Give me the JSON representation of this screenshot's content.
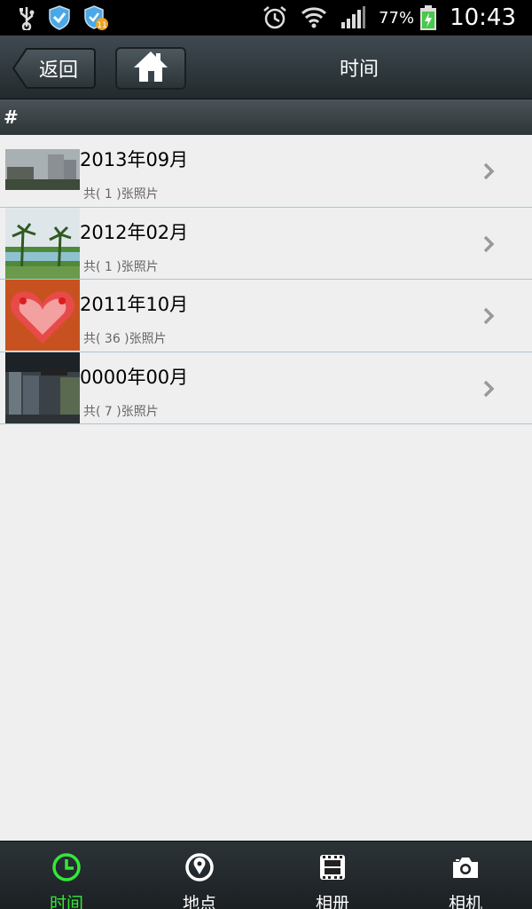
{
  "status_bar": {
    "battery_percent": "77%",
    "time": "10:43",
    "icons": [
      "usb-icon",
      "shield-icon",
      "shield-badge-icon",
      "alarm-icon",
      "wifi-icon",
      "signal-icon",
      "battery-charging-icon"
    ]
  },
  "header": {
    "back_label": "返回",
    "home_icon": "home-icon",
    "title": "时间"
  },
  "section": {
    "label": "#"
  },
  "items": [
    {
      "title": "2013年09月",
      "subtitle": "共( 1 )张照片",
      "thumb": "city-photo"
    },
    {
      "title": "2012年02月",
      "subtitle": "共( 1 )张照片",
      "thumb": "palm-resort-photo"
    },
    {
      "title": "2011年10月",
      "subtitle": "共( 36 )张照片",
      "thumb": "heart-cake-photo"
    },
    {
      "title": "0000年00月",
      "subtitle": "共( 7 )张照片",
      "thumb": "escalator-photo"
    }
  ],
  "bottom_nav": [
    {
      "label": "时间",
      "icon": "clock-icon",
      "active": true
    },
    {
      "label": "地点",
      "icon": "location-pin-icon",
      "active": false
    },
    {
      "label": "相册",
      "icon": "film-album-icon",
      "active": false
    },
    {
      "label": "相机",
      "icon": "camera-icon",
      "active": false
    }
  ],
  "colors": {
    "accent": "#35e83a",
    "divider": "#a9c4d9",
    "background": "#efefef"
  }
}
